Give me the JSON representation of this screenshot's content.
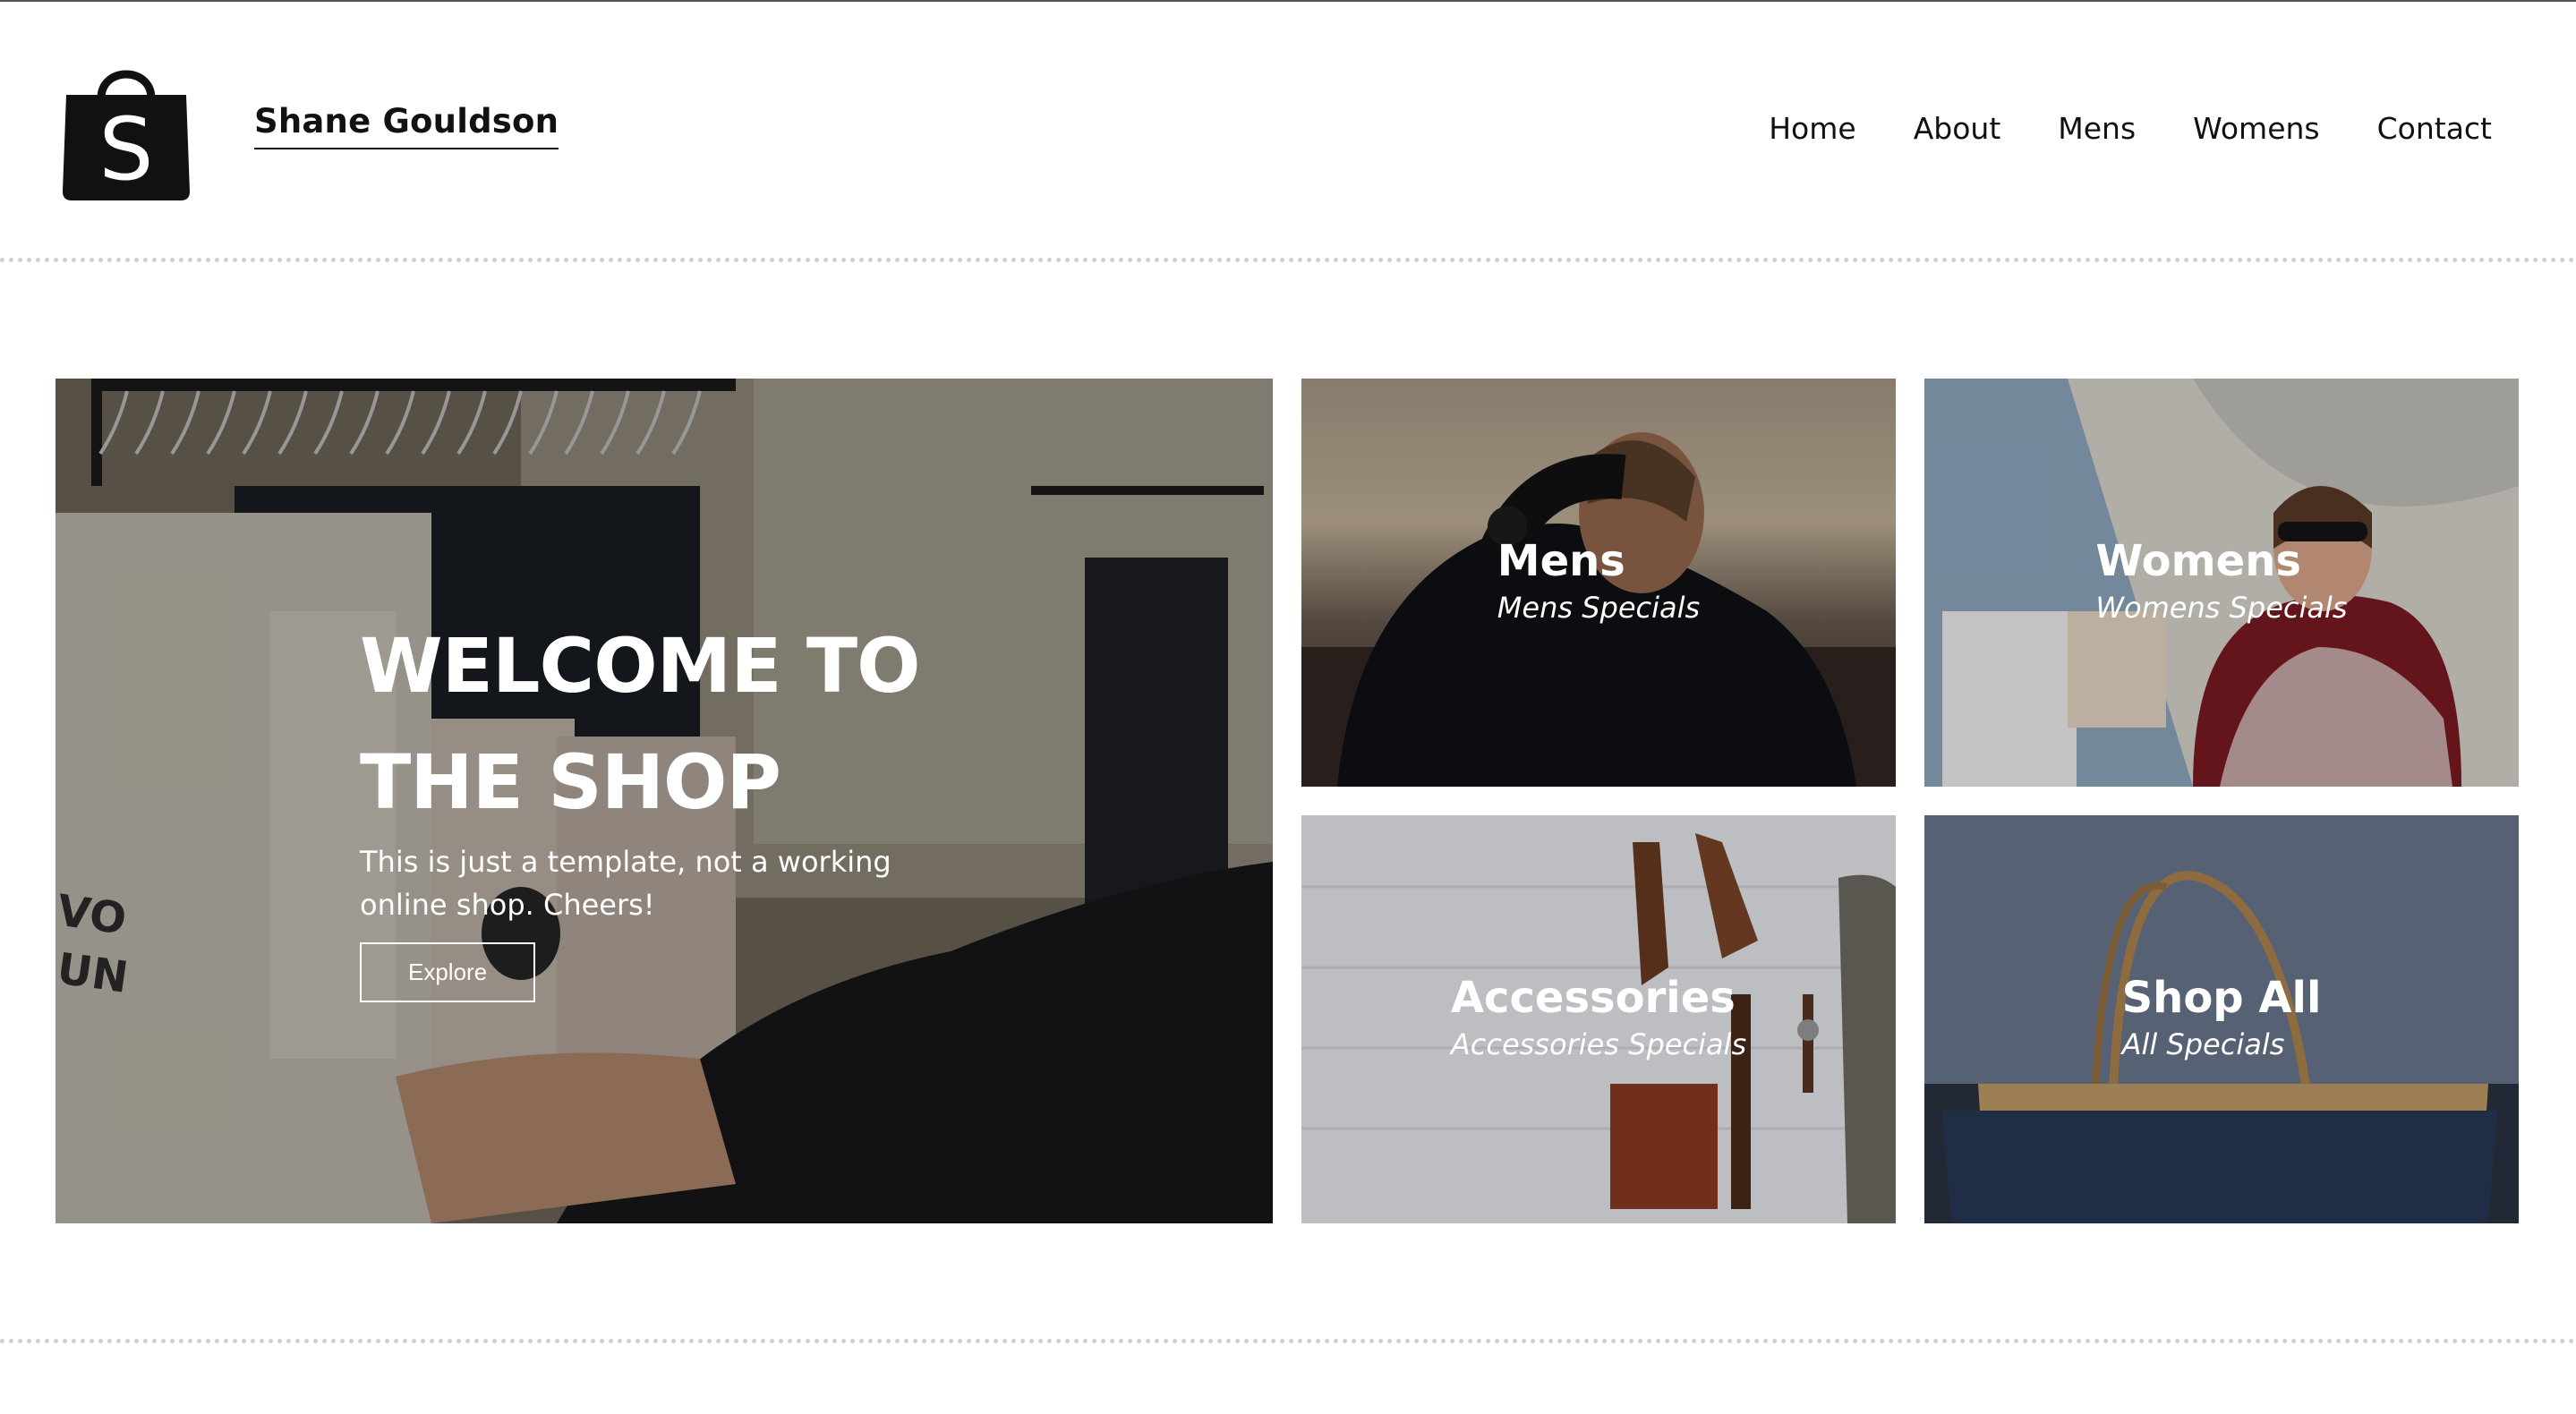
{
  "header": {
    "brand": "Shane Gouldson",
    "logo_letter": "S",
    "nav": [
      "Home",
      "About",
      "Mens",
      "Womens",
      "Contact"
    ]
  },
  "hero": {
    "title_line1": "WELCOME TO",
    "title_line2": "THE SHOP",
    "subtitle": "This is just a template, not a working online shop. Cheers!",
    "button": "Explore",
    "shirt_text": "VO\nUN"
  },
  "categories": [
    {
      "title": "Mens",
      "subtitle": "Mens Specials"
    },
    {
      "title": "Womens",
      "subtitle": "Womens Specials"
    },
    {
      "title": "Accessories",
      "subtitle": "Accessories Specials"
    },
    {
      "title": "Shop All",
      "subtitle": "All Specials"
    }
  ],
  "icons": {
    "logo": "shopping-bag-icon"
  },
  "colors": {
    "text": "#111111",
    "overlay": "rgba(0,0,0,0.35)",
    "divider": "#cfcfcf"
  }
}
